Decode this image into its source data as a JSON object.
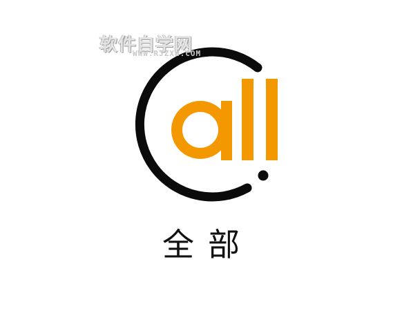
{
  "logo": {
    "text": "all",
    "colors": {
      "ring": "#0b0b0b",
      "text": "#f39800",
      "background": "#ffffff"
    }
  },
  "watermark": {
    "main": "软件自学网",
    "sub": "WWW.RJZXW.COM"
  },
  "caption": "全部"
}
